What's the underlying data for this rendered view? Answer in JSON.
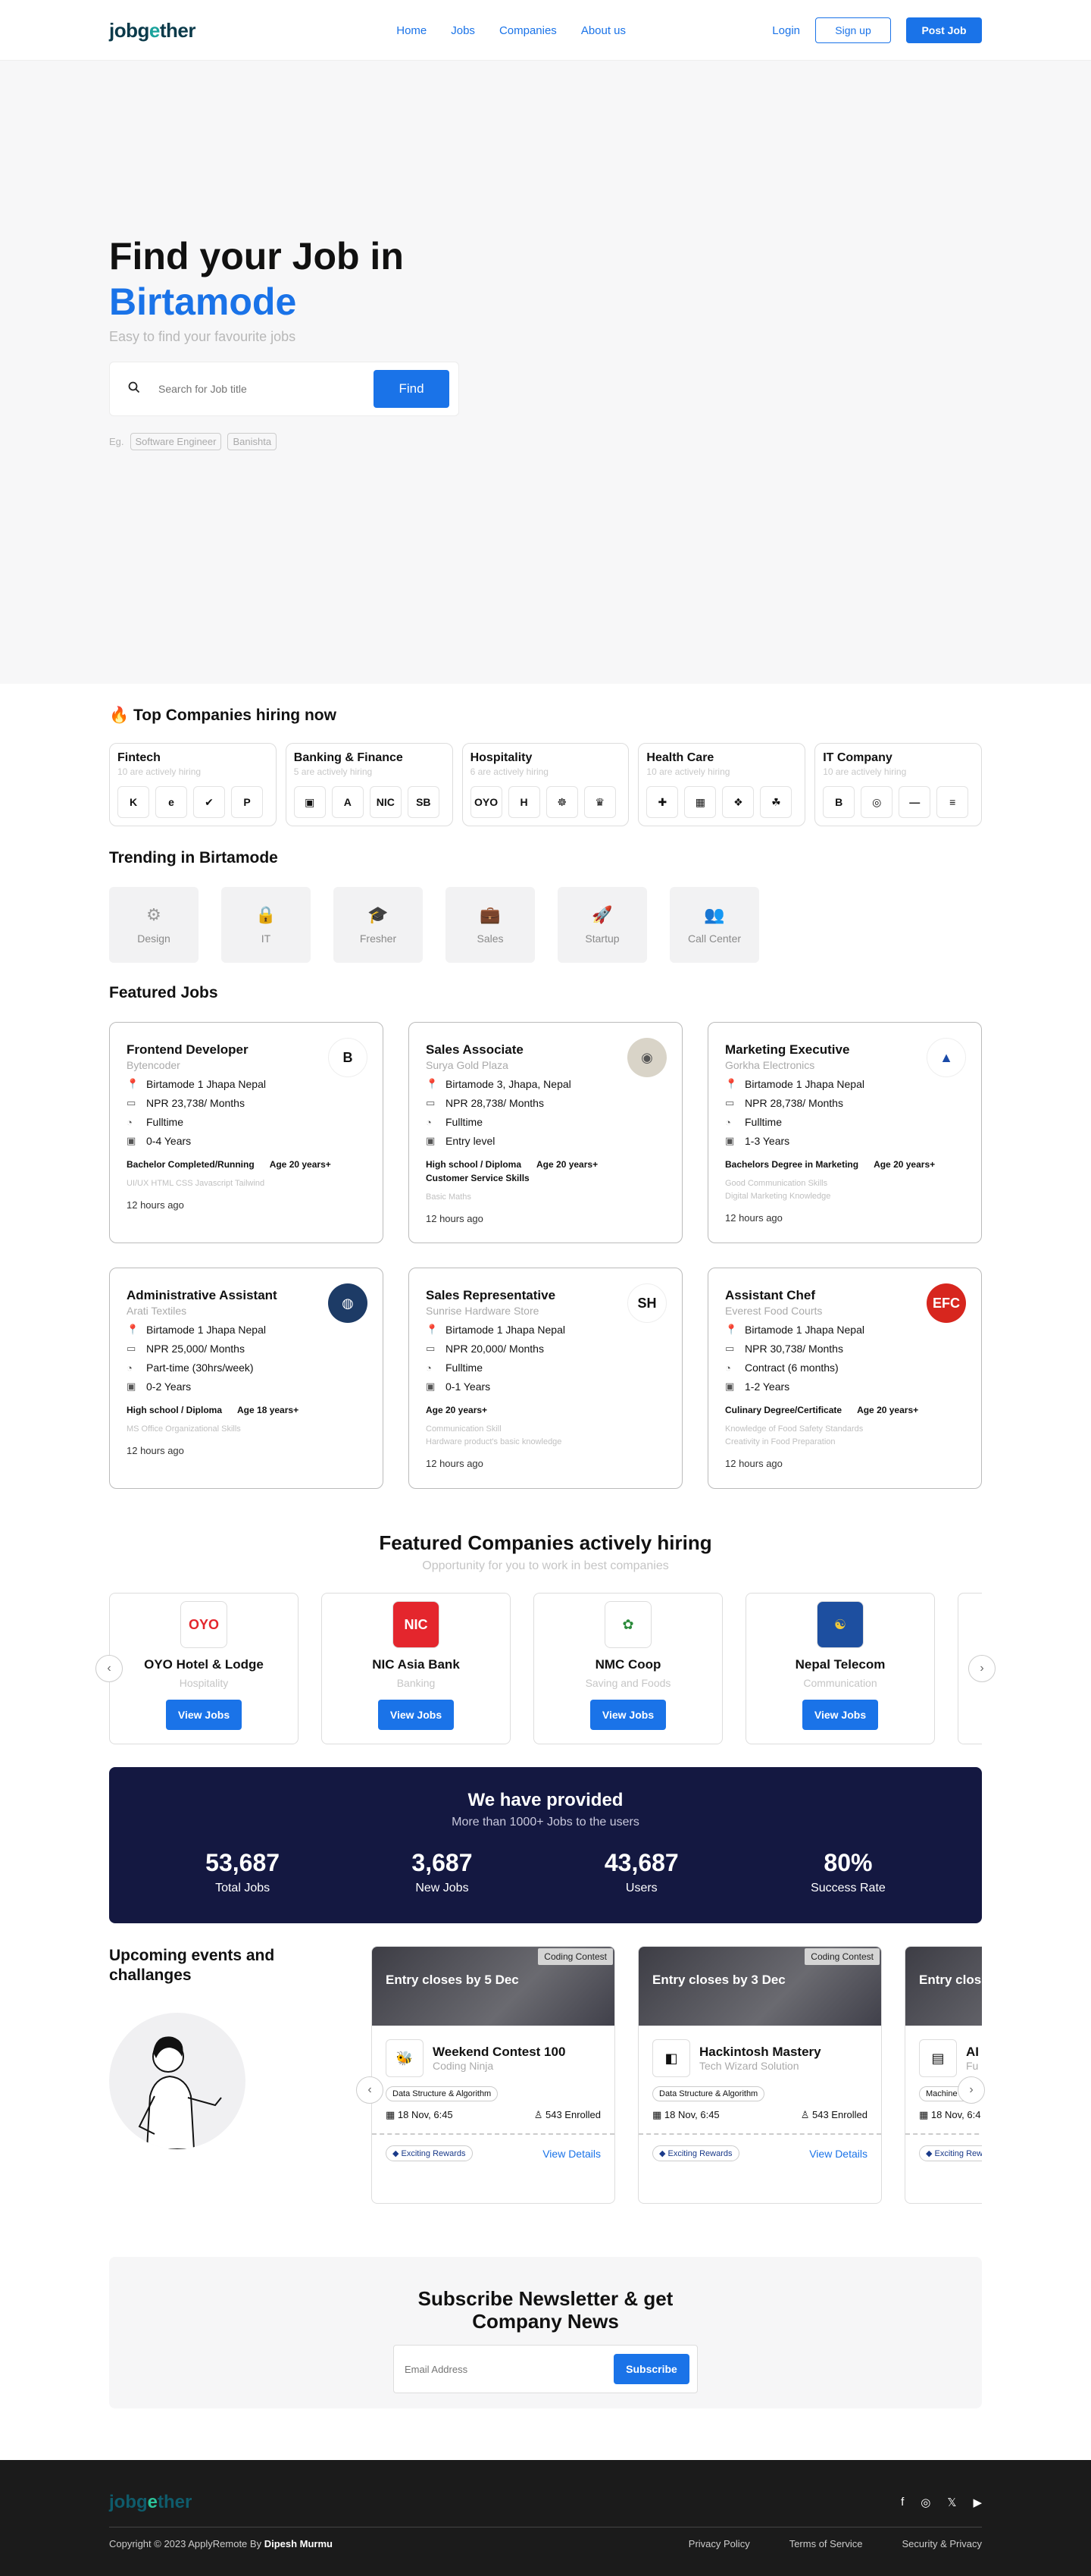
{
  "header": {
    "logo_main": "jobg",
    "logo_accent": "e",
    "logo_rest": "ther",
    "nav": [
      "Home",
      "Jobs",
      "Companies",
      "About us"
    ],
    "login": "Login",
    "signup": "Sign up",
    "post_job": "Post Job"
  },
  "hero": {
    "title_line1": "Find your Job in",
    "title_line2": "Birtamode",
    "subtitle": "Easy to find your favourite jobs",
    "search_placeholder": "Search for Job title",
    "find_label": "Find",
    "eg_label": "Eg.",
    "examples": [
      "Software Engineer",
      "Banishta"
    ]
  },
  "top_companies": {
    "title": "Top Companies hiring now",
    "categories": [
      {
        "name": "Fintech",
        "hint": "10 are actively hiring",
        "logos": [
          "K",
          "e",
          "✔",
          "P"
        ]
      },
      {
        "name": "Banking & Finance",
        "hint": "5 are actively hiring",
        "logos": [
          "▣",
          "A",
          "NIC",
          "SB"
        ]
      },
      {
        "name": "Hospitality",
        "hint": "6 are actively hiring",
        "logos": [
          "OYO",
          "H",
          "☸",
          "♛"
        ]
      },
      {
        "name": "Health Care",
        "hint": "10 are actively hiring",
        "logos": [
          "✚",
          "▦",
          "❖",
          "☘"
        ]
      },
      {
        "name": "IT Company",
        "hint": "10 are actively hiring",
        "logos": [
          "B",
          "◎",
          "—",
          "≡"
        ]
      }
    ]
  },
  "trending": {
    "title": "Trending in Birtamode",
    "items": [
      {
        "label": "Design",
        "icon": "⚙"
      },
      {
        "label": "IT",
        "icon": "🔒"
      },
      {
        "label": "Fresher",
        "icon": "🎓"
      },
      {
        "label": "Sales",
        "icon": "💼"
      },
      {
        "label": "Startup",
        "icon": "🚀"
      },
      {
        "label": "Call Center",
        "icon": "👥"
      }
    ]
  },
  "featured_jobs": {
    "title": "Featured Jobs",
    "jobs": [
      {
        "title": "Frontend Developer",
        "company": "Bytencoder",
        "location": "Birtamode 1 Jhapa Nepal",
        "salary": "NPR 23,738/ Months",
        "type": "Fulltime",
        "exp": "0-4 Years",
        "edu": "Bachelor Completed/Running",
        "age": "Age 20 years+",
        "skills": "UI/UX    HTML    CSS    Javascript    Tailwind",
        "time": "12 hours ago",
        "logo": "B",
        "logo_bg": "#ffffff",
        "logo_fg": "#111111"
      },
      {
        "title": "Sales Associate",
        "company": "Surya Gold Plaza",
        "location": "Birtamode 3, Jhapa, Nepal",
        "salary": "NPR 28,738/ Months",
        "type": "Fulltime",
        "exp": "Entry level",
        "edu": "High school / Diploma",
        "age": "Age 20 years+",
        "extra": "Customer Service Skills",
        "skills": "Basic Maths",
        "time": "12 hours ago",
        "logo": "◉",
        "logo_bg": "#d9d4c8",
        "logo_fg": "#555555"
      },
      {
        "title": "Marketing Executive",
        "company": "Gorkha Electronics",
        "location": "Birtamode 1 Jhapa Nepal",
        "salary": "NPR 28,738/ Months",
        "type": "Fulltime",
        "exp": "1-3 Years",
        "edu": "Bachelors Degree in Marketing",
        "age": "Age 20 years+",
        "skills": "Good Communication Skills\nDigital Marketing Knowledge",
        "time": "12 hours ago",
        "logo": "▲",
        "logo_bg": "#ffffff",
        "logo_fg": "#1a4aa8"
      },
      {
        "title": "Administrative Assistant",
        "company": "Arati Textiles",
        "location": "Birtamode 1 Jhapa Nepal",
        "salary": "NPR 25,000/ Months",
        "type": "Part-time (30hrs/week)",
        "exp": "0-2 Years",
        "edu": "High school / Diploma",
        "age": "Age 18 years+",
        "skills": "MS Office    Organizational Skills",
        "time": "12 hours ago",
        "logo": "◍",
        "logo_bg": "#1d3b66",
        "logo_fg": "#ffffff"
      },
      {
        "title": "Sales Representative",
        "company": "Sunrise Hardware Store",
        "location": "Birtamode 1 Jhapa Nepal",
        "salary": "NPR 20,000/ Months",
        "type": "Fulltime",
        "exp": "0-1 Years",
        "edu": "",
        "age": "Age 20 years+",
        "skills": "Communication Skill\nHardware product's basic knowledge",
        "time": "12 hours ago",
        "logo": "SH",
        "logo_bg": "#ffffff",
        "logo_fg": "#111111"
      },
      {
        "title": "Assistant Chef",
        "company": "Everest Food Courts",
        "location": "Birtamode 1 Jhapa Nepal",
        "salary": "NPR 30,738/ Months",
        "type": "Contract (6 months)",
        "exp": "1-2 Years",
        "edu": "Culinary Degree/Certificate",
        "age": "Age 20 years+",
        "skills": "Knowledge of Food Safety Standards\nCreativity in Food Preparation",
        "time": "12 hours ago",
        "logo": "EFC",
        "logo_bg": "#d7261e",
        "logo_fg": "#ffffff"
      }
    ]
  },
  "featured_companies": {
    "title": "Featured Companies actively hiring",
    "subtitle": "Opportunity for you to work in best companies",
    "view_label": "View Jobs",
    "companies": [
      {
        "name": "OYO Hotel & Lodge",
        "industry": "Hospitality",
        "logo": "OYO",
        "logo_bg": "#ffffff",
        "logo_fg": "#e4262d"
      },
      {
        "name": "NIC Asia Bank",
        "industry": "Banking",
        "logo": "NIC",
        "logo_bg": "#e4262d",
        "logo_fg": "#ffffff"
      },
      {
        "name": "NMC Coop",
        "industry": "Saving and Foods",
        "logo": "✿",
        "logo_bg": "#ffffff",
        "logo_fg": "#2a8a3a"
      },
      {
        "name": "Nepal Telecom",
        "industry": "Communication",
        "logo": "☯",
        "logo_bg": "#1d4fa0",
        "logo_fg": "#f0c93a"
      }
    ]
  },
  "stats": {
    "title": "We have provided",
    "subtitle": "More than 1000+ Jobs to the users",
    "items": [
      {
        "value": "53,687",
        "label": "Total Jobs"
      },
      {
        "value": "3,687",
        "label": "New Jobs"
      },
      {
        "value": "43,687",
        "label": "Users"
      },
      {
        "value": "80%",
        "label": "Success Rate"
      }
    ]
  },
  "events": {
    "title": "Upcoming events and challanges",
    "details_label": "View Details",
    "rewards_label": "Exciting Rewards",
    "items": [
      {
        "tag": "Coding Contest",
        "closes": "Entry closes by 5 Dec",
        "title": "Weekend Contest 100",
        "org": "Coding Ninja",
        "category": "Data Structure & Algorithm",
        "date": "18 Nov, 6:45",
        "enrolled": "543 Enrolled",
        "logo": "🐝"
      },
      {
        "tag": "Coding Contest",
        "closes": "Entry closes by 3 Dec",
        "title": "Hackintosh Mastery",
        "org": "Tech Wizard Solution",
        "category": "Data Structure & Algorithm",
        "date": "18 Nov, 6:45",
        "enrolled": "543 Enrolled",
        "logo": "◧"
      },
      {
        "tag": "",
        "closes": "Entry clos",
        "title": "AI De",
        "org": "Fu",
        "category": "Machine Lea",
        "date": "18 Nov, 6:4",
        "enrolled": "",
        "logo": "▤"
      }
    ]
  },
  "newsletter": {
    "title_line1": "Subscribe Newsletter & get",
    "title_line2": "Company News",
    "placeholder": "Email Address",
    "button": "Subscribe"
  },
  "footer": {
    "logo_main": "jobg",
    "logo_accent": "e",
    "logo_rest": "ther",
    "copyright": "Copyright © 2023 ApplyRemote By ",
    "author": "Dipesh Murmu",
    "links": [
      "Privacy Policy",
      "Terms of Service",
      "Security & Privacy"
    ],
    "social": [
      "f",
      "◎",
      "𝕏",
      "▶"
    ]
  },
  "colors": {
    "accent": "#1a73e8",
    "stats_bg": "#141841",
    "footer_bg": "#1b1b1b"
  }
}
